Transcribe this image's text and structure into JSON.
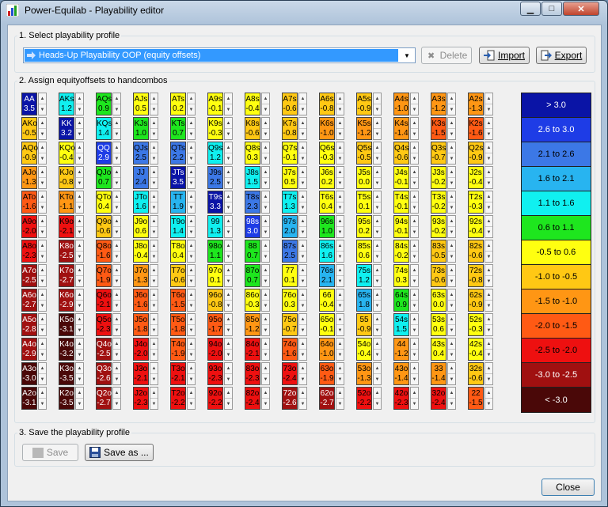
{
  "window": {
    "title": "Power-Equilab - Playability editor"
  },
  "section1": {
    "label": "1. Select playability profile",
    "profile": "Heads-Up Playability OOP  (equity offsets)",
    "delete_label": "Delete",
    "import_label": "Import",
    "export_label": "Export"
  },
  "section2": {
    "label": "2. Assign equityoffsets to handcombos"
  },
  "grid": {
    "rows": [
      [
        [
          "AA",
          "3.5"
        ],
        [
          "AKs",
          "1.2"
        ],
        [
          "AQs",
          "0.9"
        ],
        [
          "AJs",
          "0.5"
        ],
        [
          "ATs",
          "0.2"
        ],
        [
          "A9s",
          "-0.1"
        ],
        [
          "A8s",
          "-0.4"
        ],
        [
          "A7s",
          "-0.6"
        ],
        [
          "A6s",
          "-0.8"
        ],
        [
          "A5s",
          "-0.9"
        ],
        [
          "A4s",
          "-1.0"
        ],
        [
          "A3s",
          "-1.2"
        ],
        [
          "A2s",
          "-1.3"
        ]
      ],
      [
        [
          "AKo",
          "-0.5"
        ],
        [
          "KK",
          "3.2"
        ],
        [
          "KQs",
          "1.4"
        ],
        [
          "KJs",
          "1.0"
        ],
        [
          "KTs",
          "0.7"
        ],
        [
          "K9s",
          "-0.3"
        ],
        [
          "K8s",
          "-0.6"
        ],
        [
          "K7s",
          "-0.8"
        ],
        [
          "K6s",
          "-1.0"
        ],
        [
          "K5s",
          "-1.2"
        ],
        [
          "K4s",
          "-1.4"
        ],
        [
          "K3s",
          "-1.5"
        ],
        [
          "K2s",
          "-1.6"
        ]
      ],
      [
        [
          "AQo",
          "-0.9"
        ],
        [
          "KQo",
          "-0.4"
        ],
        [
          "QQ",
          "2.9"
        ],
        [
          "QJs",
          "2.5"
        ],
        [
          "QTs",
          "2.2"
        ],
        [
          "Q9s",
          "1.2"
        ],
        [
          "Q8s",
          "0.3"
        ],
        [
          "Q7s",
          "-0.1"
        ],
        [
          "Q6s",
          "-0.3"
        ],
        [
          "Q5s",
          "-0.5"
        ],
        [
          "Q4s",
          "-0.6"
        ],
        [
          "Q3s",
          "-0.7"
        ],
        [
          "Q2s",
          "-0.9"
        ]
      ],
      [
        [
          "AJo",
          "-1.3"
        ],
        [
          "KJo",
          "-0.8"
        ],
        [
          "QJo",
          "0.7"
        ],
        [
          "JJ",
          "2.4"
        ],
        [
          "JTs",
          "3.5"
        ],
        [
          "J9s",
          "2.5"
        ],
        [
          "J8s",
          "1.5"
        ],
        [
          "J7s",
          "0.5"
        ],
        [
          "J6s",
          "0.2"
        ],
        [
          "J5s",
          "0.0"
        ],
        [
          "J4s",
          "-0.1"
        ],
        [
          "J3s",
          "-0.2"
        ],
        [
          "J2s",
          "-0.4"
        ]
      ],
      [
        [
          "ATo",
          "-1.6"
        ],
        [
          "KTo",
          "-1.1"
        ],
        [
          "QTo",
          "0.4"
        ],
        [
          "JTo",
          "1.6"
        ],
        [
          "TT",
          "1.9"
        ],
        [
          "T9s",
          "3.3"
        ],
        [
          "T8s",
          "2.3"
        ],
        [
          "T7s",
          "1.3"
        ],
        [
          "T6s",
          "0.4"
        ],
        [
          "T5s",
          "0.1"
        ],
        [
          "T4s",
          "-0.1"
        ],
        [
          "T3s",
          "-0.2"
        ],
        [
          "T2s",
          "-0.3"
        ]
      ],
      [
        [
          "A9o",
          "-2.0"
        ],
        [
          "K9o",
          "-2.1"
        ],
        [
          "Q9o",
          "-0.6"
        ],
        [
          "J9o",
          "0.6"
        ],
        [
          "T9o",
          "1.4"
        ],
        [
          "99",
          "1.3"
        ],
        [
          "98s",
          "3.0"
        ],
        [
          "97s",
          "2.0"
        ],
        [
          "96s",
          "1.0"
        ],
        [
          "95s",
          "0.2"
        ],
        [
          "94s",
          "-0.1"
        ],
        [
          "93s",
          "-0.2"
        ],
        [
          "92s",
          "-0.4"
        ]
      ],
      [
        [
          "A8o",
          "-2.3"
        ],
        [
          "K8o",
          "-2.5"
        ],
        [
          "Q8o",
          "-1.6"
        ],
        [
          "J8o",
          "-0.4"
        ],
        [
          "T8o",
          "0.4"
        ],
        [
          "98o",
          "1.1"
        ],
        [
          "88",
          "0.7"
        ],
        [
          "87s",
          "2.5"
        ],
        [
          "86s",
          "1.6"
        ],
        [
          "85s",
          "0.6"
        ],
        [
          "84s",
          "-0.2"
        ],
        [
          "83s",
          "-0.5"
        ],
        [
          "82s",
          "-0.6"
        ]
      ],
      [
        [
          "A7o",
          "-2.5"
        ],
        [
          "K7o",
          "-2.7"
        ],
        [
          "Q7o",
          "-1.9"
        ],
        [
          "J7o",
          "-1.3"
        ],
        [
          "T7o",
          "-0.6"
        ],
        [
          "97o",
          "0.1"
        ],
        [
          "87o",
          "0.7"
        ],
        [
          "77",
          "0.1"
        ],
        [
          "76s",
          "2.1"
        ],
        [
          "75s",
          "1.2"
        ],
        [
          "74s",
          "0.3"
        ],
        [
          "73s",
          "-0.6"
        ],
        [
          "72s",
          "-0.8"
        ]
      ],
      [
        [
          "A6o",
          "-2.7"
        ],
        [
          "K6o",
          "-2.9"
        ],
        [
          "Q6o",
          "-2.1"
        ],
        [
          "J6o",
          "-1.6"
        ],
        [
          "T6o",
          "-1.5"
        ],
        [
          "96o",
          "-0.8"
        ],
        [
          "86o",
          "-0.3"
        ],
        [
          "76o",
          "0.3"
        ],
        [
          "66",
          "-0.4"
        ],
        [
          "65s",
          "1.8"
        ],
        [
          "64s",
          "0.9"
        ],
        [
          "63s",
          "0.0"
        ],
        [
          "62s",
          "-0.9"
        ]
      ],
      [
        [
          "A5o",
          "-2.8"
        ],
        [
          "K5o",
          "-3.1"
        ],
        [
          "Q5o",
          "-2.3"
        ],
        [
          "J5o",
          "-1.8"
        ],
        [
          "T5o",
          "-1.8"
        ],
        [
          "95o",
          "-1.7"
        ],
        [
          "85o",
          "-1.2"
        ],
        [
          "75o",
          "-0.7"
        ],
        [
          "65o",
          "-0.1"
        ],
        [
          "55",
          "-0.9"
        ],
        [
          "54s",
          "1.5"
        ],
        [
          "53s",
          "0.6"
        ],
        [
          "52s",
          "-0.3"
        ]
      ],
      [
        [
          "A4o",
          "-2.9"
        ],
        [
          "K4o",
          "-3.2"
        ],
        [
          "Q4o",
          "-2.5"
        ],
        [
          "J4o",
          "-2.0"
        ],
        [
          "T4o",
          "-1.9"
        ],
        [
          "94o",
          "-2.0"
        ],
        [
          "84o",
          "-2.1"
        ],
        [
          "74o",
          "-1.6"
        ],
        [
          "64o",
          "-1.0"
        ],
        [
          "54o",
          "-0.4"
        ],
        [
          "44",
          "-1.2"
        ],
        [
          "43s",
          "0.4"
        ],
        [
          "42s",
          "-0.4"
        ]
      ],
      [
        [
          "A3o",
          "-3.0"
        ],
        [
          "K3o",
          "-3.5"
        ],
        [
          "Q3o",
          "-2.6"
        ],
        [
          "J3o",
          "-2.1"
        ],
        [
          "T3o",
          "-2.1"
        ],
        [
          "93o",
          "-2.3"
        ],
        [
          "83o",
          "-2.3"
        ],
        [
          "73o",
          "-2.4"
        ],
        [
          "63o",
          "-1.9"
        ],
        [
          "53o",
          "-1.3"
        ],
        [
          "43o",
          "-1.4"
        ],
        [
          "33",
          "-1.4"
        ],
        [
          "32s",
          "-0.6"
        ]
      ],
      [
        [
          "A2o",
          "-3.1"
        ],
        [
          "K2o",
          "-3.5"
        ],
        [
          "Q2o",
          "-2.7"
        ],
        [
          "J2o",
          "-2.3"
        ],
        [
          "T2o",
          "-2.2"
        ],
        [
          "92o",
          "-2.2"
        ],
        [
          "82o",
          "-2.4"
        ],
        [
          "72o",
          "-2.6"
        ],
        [
          "62o",
          "-2.7"
        ],
        [
          "52o",
          "-2.2"
        ],
        [
          "42o",
          "-2.3"
        ],
        [
          "32o",
          "-2.4"
        ],
        [
          "22",
          "-1.5"
        ]
      ]
    ]
  },
  "legend": [
    {
      "label": "> 3.0",
      "color": "#0a14a6",
      "text": "#ffffff"
    },
    {
      "label": "2.6 to 3.0",
      "color": "#1e3ce6",
      "text": "#ffffff"
    },
    {
      "label": "2.1 to 2.6",
      "color": "#3c78e6",
      "text": "#000000"
    },
    {
      "label": "1.6 to 2.1",
      "color": "#28b4f0",
      "text": "#000000"
    },
    {
      "label": "1.1 to 1.6",
      "color": "#10f0f0",
      "text": "#000000"
    },
    {
      "label": "0.6 to 1.1",
      "color": "#1ee61e",
      "text": "#000000"
    },
    {
      "label": "-0.5 to 0.6",
      "color": "#ffff10",
      "text": "#000000"
    },
    {
      "label": "-1.0 to -0.5",
      "color": "#ffc814",
      "text": "#000000"
    },
    {
      "label": "-1.5 to -1.0",
      "color": "#ff9614",
      "text": "#000000"
    },
    {
      "label": "-2.0 to -1.5",
      "color": "#ff5a14",
      "text": "#000000"
    },
    {
      "label": "-2.5 to -2.0",
      "color": "#ee1010",
      "text": "#000000"
    },
    {
      "label": "-3.0 to -2.5",
      "color": "#a01010",
      "text": "#ffffff"
    },
    {
      "label": "< -3.0",
      "color": "#4a0808",
      "text": "#ffffff"
    }
  ],
  "section3": {
    "label": "3. Save the playability profile",
    "save_label": "Save",
    "save_as_label": "Save as ..."
  },
  "footer": {
    "close_label": "Close"
  }
}
